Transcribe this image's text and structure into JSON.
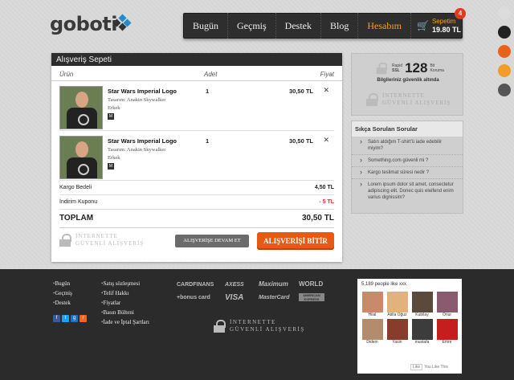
{
  "brand": {
    "name": "goboti"
  },
  "nav": {
    "items": [
      "Bugün",
      "Geçmiş",
      "Destek",
      "Blog"
    ],
    "account": "Hesabım",
    "cart_label": "Sepetim",
    "cart_total": "19.80 TL",
    "cart_count": "4"
  },
  "swatches": [
    "#dcdcdc",
    "#222222",
    "#e8621b",
    "#f39c2a",
    "#555555"
  ],
  "cart": {
    "title": "Alışveriş Sepeti",
    "columns": {
      "product": "Ürün",
      "qty": "Adet",
      "price": "Fiyat"
    },
    "items": [
      {
        "name": "Star Wars Imperial Logo",
        "designer": "Tasarım: Anakin Skywalker",
        "gender": "Erkek",
        "size": "M",
        "qty": "1",
        "price": "30,50 TL"
      },
      {
        "name": "Star Wars Imperial Logo",
        "designer": "Tasarım: Anakin Skywalker",
        "gender": "Erkek",
        "size": "M",
        "qty": "1",
        "price": "30,50 TL"
      }
    ],
    "shipping_label": "Kargo Bedeli",
    "shipping_value": "4,50 TL",
    "discount_label": "İndirim Kuponu",
    "discount_value": "- 5 TL",
    "total_label": "TOPLAM",
    "total_value": "30,50 TL",
    "secure_line1": "İNTERNETTE",
    "secure_line2": "GÜVENLİ ALIŞVERİŞ",
    "continue_button": "ALIŞVERİŞE DEVAM ET",
    "checkout_button": "ALIŞVERİŞİ BİTİR"
  },
  "ssl": {
    "small_left_1": "Rapid",
    "small_left_2": "SSL",
    "bits": "128",
    "small_right_1": "Bit",
    "small_right_2": "Koruma",
    "caption": "Bilgileriniz güvenlik altında",
    "secure_line1": "İNTERNETTE",
    "secure_line2": "GÜVENLİ ALIŞVERİŞ"
  },
  "faq": {
    "title": "Sıkça Sorulan Sorular",
    "items": [
      "Satın aldığım T-shirt'ü iade edebilir miyim?",
      "Something.com güvenli mi ?",
      "Kargo teslimat süresi nedir ?",
      "Lorem ipsum dolor sit amet, consectetur adipiscing elit. Donec quis eleifend enim varius dignissim?"
    ]
  },
  "footer": {
    "col1": [
      "Bugün",
      "Geçmiş",
      "Destek"
    ],
    "col2": [
      "Satış sözleşmesi",
      "Telif Hakkı",
      "Fiyatlar",
      "Basın Bülteni",
      "İade ve İptal Şartları"
    ],
    "cards": [
      "CARDFINANS",
      "AXESS",
      "Maximum",
      "WORLD",
      "+bonus card",
      "VISA",
      "MasterCard",
      "AMERICAN EXPRESS"
    ],
    "secure_line1": "İNTERNETTE",
    "secure_line2": "GÜVENLİ ALIŞVERİŞ"
  },
  "facebook": {
    "count_text": "5,189 people like xxx",
    "people": [
      {
        "name": "Hilal",
        "color": "#c98a6b"
      },
      {
        "name": "Atilla Oğuz",
        "color": "#e2b27d"
      },
      {
        "name": "Kubilay",
        "color": "#5b4a3c"
      },
      {
        "name": "Onur",
        "color": "#8a5a6e"
      },
      {
        "name": "Didem",
        "color": "#b38b6d"
      },
      {
        "name": "Yasin",
        "color": "#8a3c2c"
      },
      {
        "name": "mustafa",
        "color": "#3c3c3c"
      },
      {
        "name": "Emre",
        "color": "#c41e1e"
      }
    ],
    "like_button": "Like",
    "like_text": "You Like This"
  }
}
